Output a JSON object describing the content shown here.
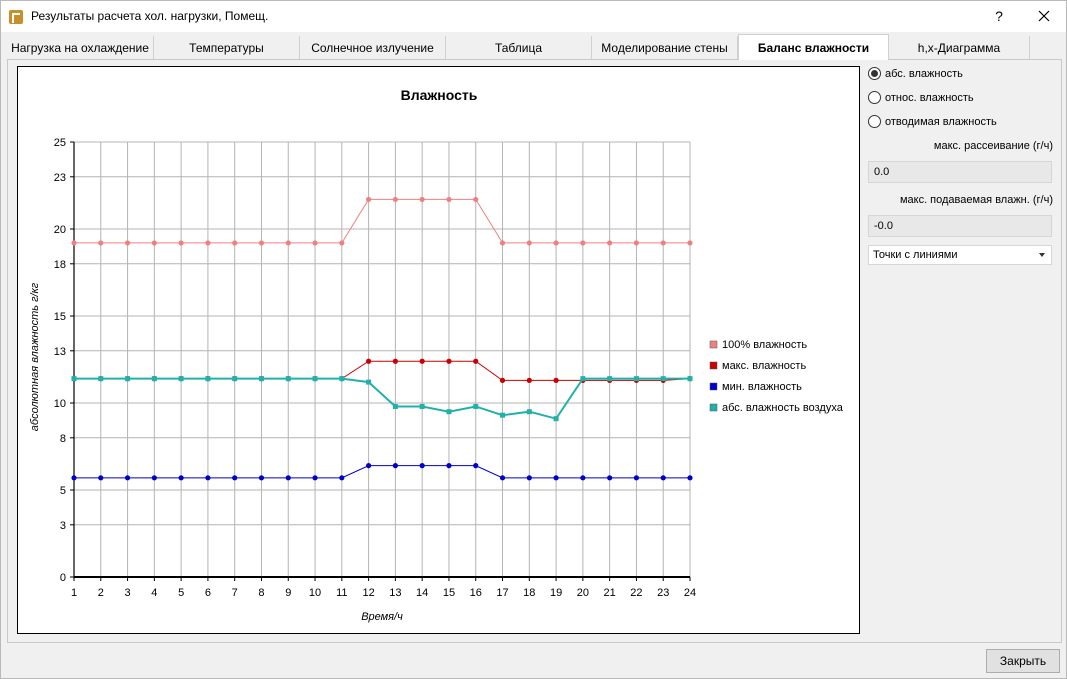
{
  "window": {
    "title": "Результаты расчета хол. нагрузки, Помещ.",
    "help": "?"
  },
  "tabs": [
    {
      "label": "Нагрузка на охлаждение"
    },
    {
      "label": "Температуры"
    },
    {
      "label": "Солнечное излучение"
    },
    {
      "label": "Таблица"
    },
    {
      "label": "Моделирование стены"
    },
    {
      "label": "Баланс влажности"
    },
    {
      "label": "h,x-Диаграмма"
    }
  ],
  "active_tab": "Баланс влажности",
  "panel": {
    "radio_abs": "абс. влажность",
    "radio_rel": "относ. влажность",
    "radio_removed": "отводимая влажность",
    "max_dissipation_label": "макс. рассеивание (г/ч)",
    "max_dissipation_value": "0.0",
    "max_supply_label": "макс. подаваемая влажн. (г/ч)",
    "max_supply_value": "-0.0",
    "display_mode": "Точки с линиями"
  },
  "footer": {
    "close_label": "Закрыть"
  },
  "chart_data": {
    "type": "line",
    "title": "Влажность",
    "xlabel": "Время/ч",
    "ylabel": "абсолютная влажность г/кг",
    "x": [
      1,
      2,
      3,
      4,
      5,
      6,
      7,
      8,
      9,
      10,
      11,
      12,
      13,
      14,
      15,
      16,
      17,
      18,
      19,
      20,
      21,
      22,
      23,
      24
    ],
    "ylim": [
      0,
      25
    ],
    "yticks": [
      0,
      3,
      5,
      8,
      10,
      13,
      15,
      18,
      20,
      23,
      25
    ],
    "grid": true,
    "legend_position": "right",
    "series": [
      {
        "name": "100% влажность",
        "color": "#f08080",
        "values": [
          19.2,
          19.2,
          19.2,
          19.2,
          19.2,
          19.2,
          19.2,
          19.2,
          19.2,
          19.2,
          19.2,
          21.7,
          21.7,
          21.7,
          21.7,
          21.7,
          19.2,
          19.2,
          19.2,
          19.2,
          19.2,
          19.2,
          19.2,
          19.2
        ]
      },
      {
        "name": "макс. влажность",
        "color": "#cc0000",
        "values": [
          11.4,
          11.4,
          11.4,
          11.4,
          11.4,
          11.4,
          11.4,
          11.4,
          11.4,
          11.4,
          11.4,
          12.4,
          12.4,
          12.4,
          12.4,
          12.4,
          11.3,
          11.3,
          11.3,
          11.3,
          11.3,
          11.3,
          11.3,
          11.4
        ]
      },
      {
        "name": "мин. влажность",
        "color": "#0000cc",
        "values": [
          5.7,
          5.7,
          5.7,
          5.7,
          5.7,
          5.7,
          5.7,
          5.7,
          5.7,
          5.7,
          5.7,
          6.4,
          6.4,
          6.4,
          6.4,
          6.4,
          5.7,
          5.7,
          5.7,
          5.7,
          5.7,
          5.7,
          5.7,
          5.7
        ]
      },
      {
        "name": "абс. влажность воздуха",
        "color": "#20b2aa",
        "values": [
          11.4,
          11.4,
          11.4,
          11.4,
          11.4,
          11.4,
          11.4,
          11.4,
          11.4,
          11.4,
          11.4,
          11.2,
          9.8,
          9.8,
          9.5,
          9.8,
          9.3,
          9.5,
          9.1,
          11.4,
          11.4,
          11.4,
          11.4,
          11.4
        ]
      }
    ]
  }
}
